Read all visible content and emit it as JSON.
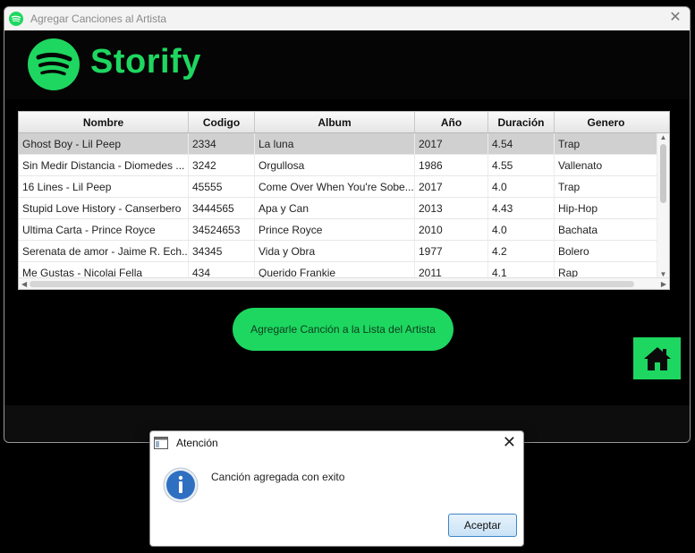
{
  "window": {
    "title": "Agregar Canciones al Artista"
  },
  "brand": {
    "name": "Storify",
    "accent": "#1ed760"
  },
  "table": {
    "columns": [
      "Nombre",
      "Codigo",
      "Album",
      "Año",
      "Duración",
      "Genero"
    ],
    "rows": [
      [
        "Ghost Boy - Lil Peep",
        "2334",
        "La luna",
        "2017",
        "4.54",
        "Trap"
      ],
      [
        "Sin Medir Distancia - Diomedes ...",
        "3242",
        "Orgullosa",
        "1986",
        "4.55",
        "Vallenato"
      ],
      [
        "16 Lines - Lil Peep",
        "45555",
        "Come Over When You're Sobe...",
        "2017",
        "4.0",
        "Trap"
      ],
      [
        "Stupid Love History - Canserbero",
        "3444565",
        "Apa y Can",
        "2013",
        "4.43",
        "Hip-Hop"
      ],
      [
        "Ultima Carta - Prince Royce",
        "34524653",
        "Prince Royce",
        "2010",
        "4.0",
        "Bachata"
      ],
      [
        "Serenata de amor - Jaime R. Ech...",
        "34345",
        "Vida y Obra",
        "1977",
        "4.2",
        "Bolero"
      ],
      [
        "Me Gustas - Nicolai Fella",
        "434",
        "Querido Frankie",
        "2011",
        "4.1",
        "Rap"
      ]
    ]
  },
  "actions": {
    "add_label": "Agregarle Canción a la Lista del Artista",
    "home_icon": "home-icon"
  },
  "dialog": {
    "title": "Atención",
    "message": "Canción agregada con exito",
    "ok_label": "Aceptar",
    "icon": "info-icon"
  }
}
